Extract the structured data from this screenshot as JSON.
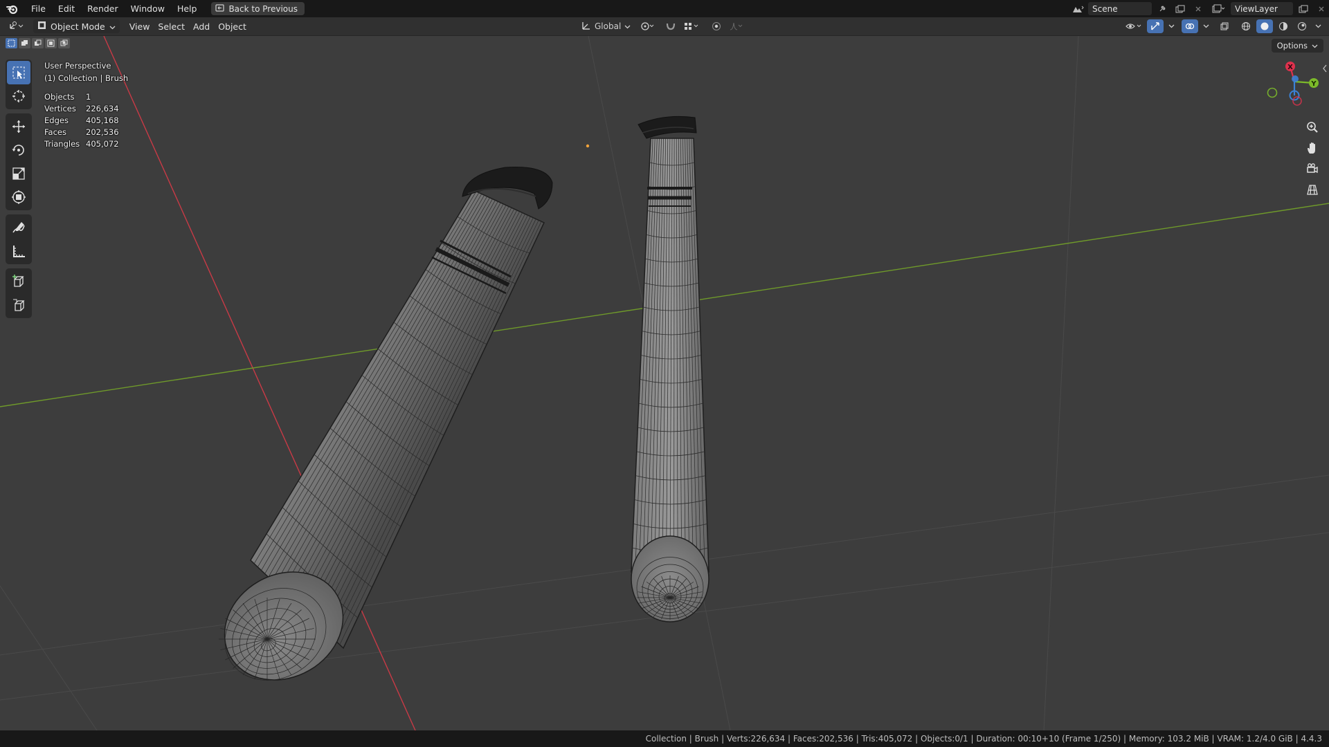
{
  "menu": {
    "items": [
      "File",
      "Edit",
      "Render",
      "Window",
      "Help"
    ],
    "back_button": "Back to Previous"
  },
  "top_right": {
    "scene_name": "Scene",
    "view_layer": "ViewLayer"
  },
  "viewport_header": {
    "mode": "Object Mode",
    "menus": [
      "View",
      "Select",
      "Add",
      "Object"
    ],
    "transform_orientation": "Global",
    "options_label": "Options"
  },
  "overlay": {
    "perspective": "User Perspective",
    "collection_info": "(1) Collection | Brush",
    "stats": [
      {
        "label": "Objects",
        "value": "1"
      },
      {
        "label": "Vertices",
        "value": "226,634"
      },
      {
        "label": "Edges",
        "value": "405,168"
      },
      {
        "label": "Faces",
        "value": "202,536"
      },
      {
        "label": "Triangles",
        "value": "405,072"
      }
    ]
  },
  "gizmo": {
    "x_label": "X",
    "y_label": "Y",
    "x_color": "#e0314d",
    "y_color": "#7cba2a",
    "z_color": "#3b82d6"
  },
  "statusbar": {
    "text": "Collection | Brush | Verts:226,634 | Faces:202,536 | Tris:405,072 | Objects:0/1 | Duration: 00:10+10 (Frame 1/250) | Memory: 103.2 MiB | VRAM: 1.2/4.0 GiB | 4.4.3"
  },
  "colors": {
    "accent": "#4772b3",
    "x_axis_line": "#c93a46",
    "y_axis_line": "#6f9a2a",
    "viewport_bg": "#3d3d3d"
  }
}
